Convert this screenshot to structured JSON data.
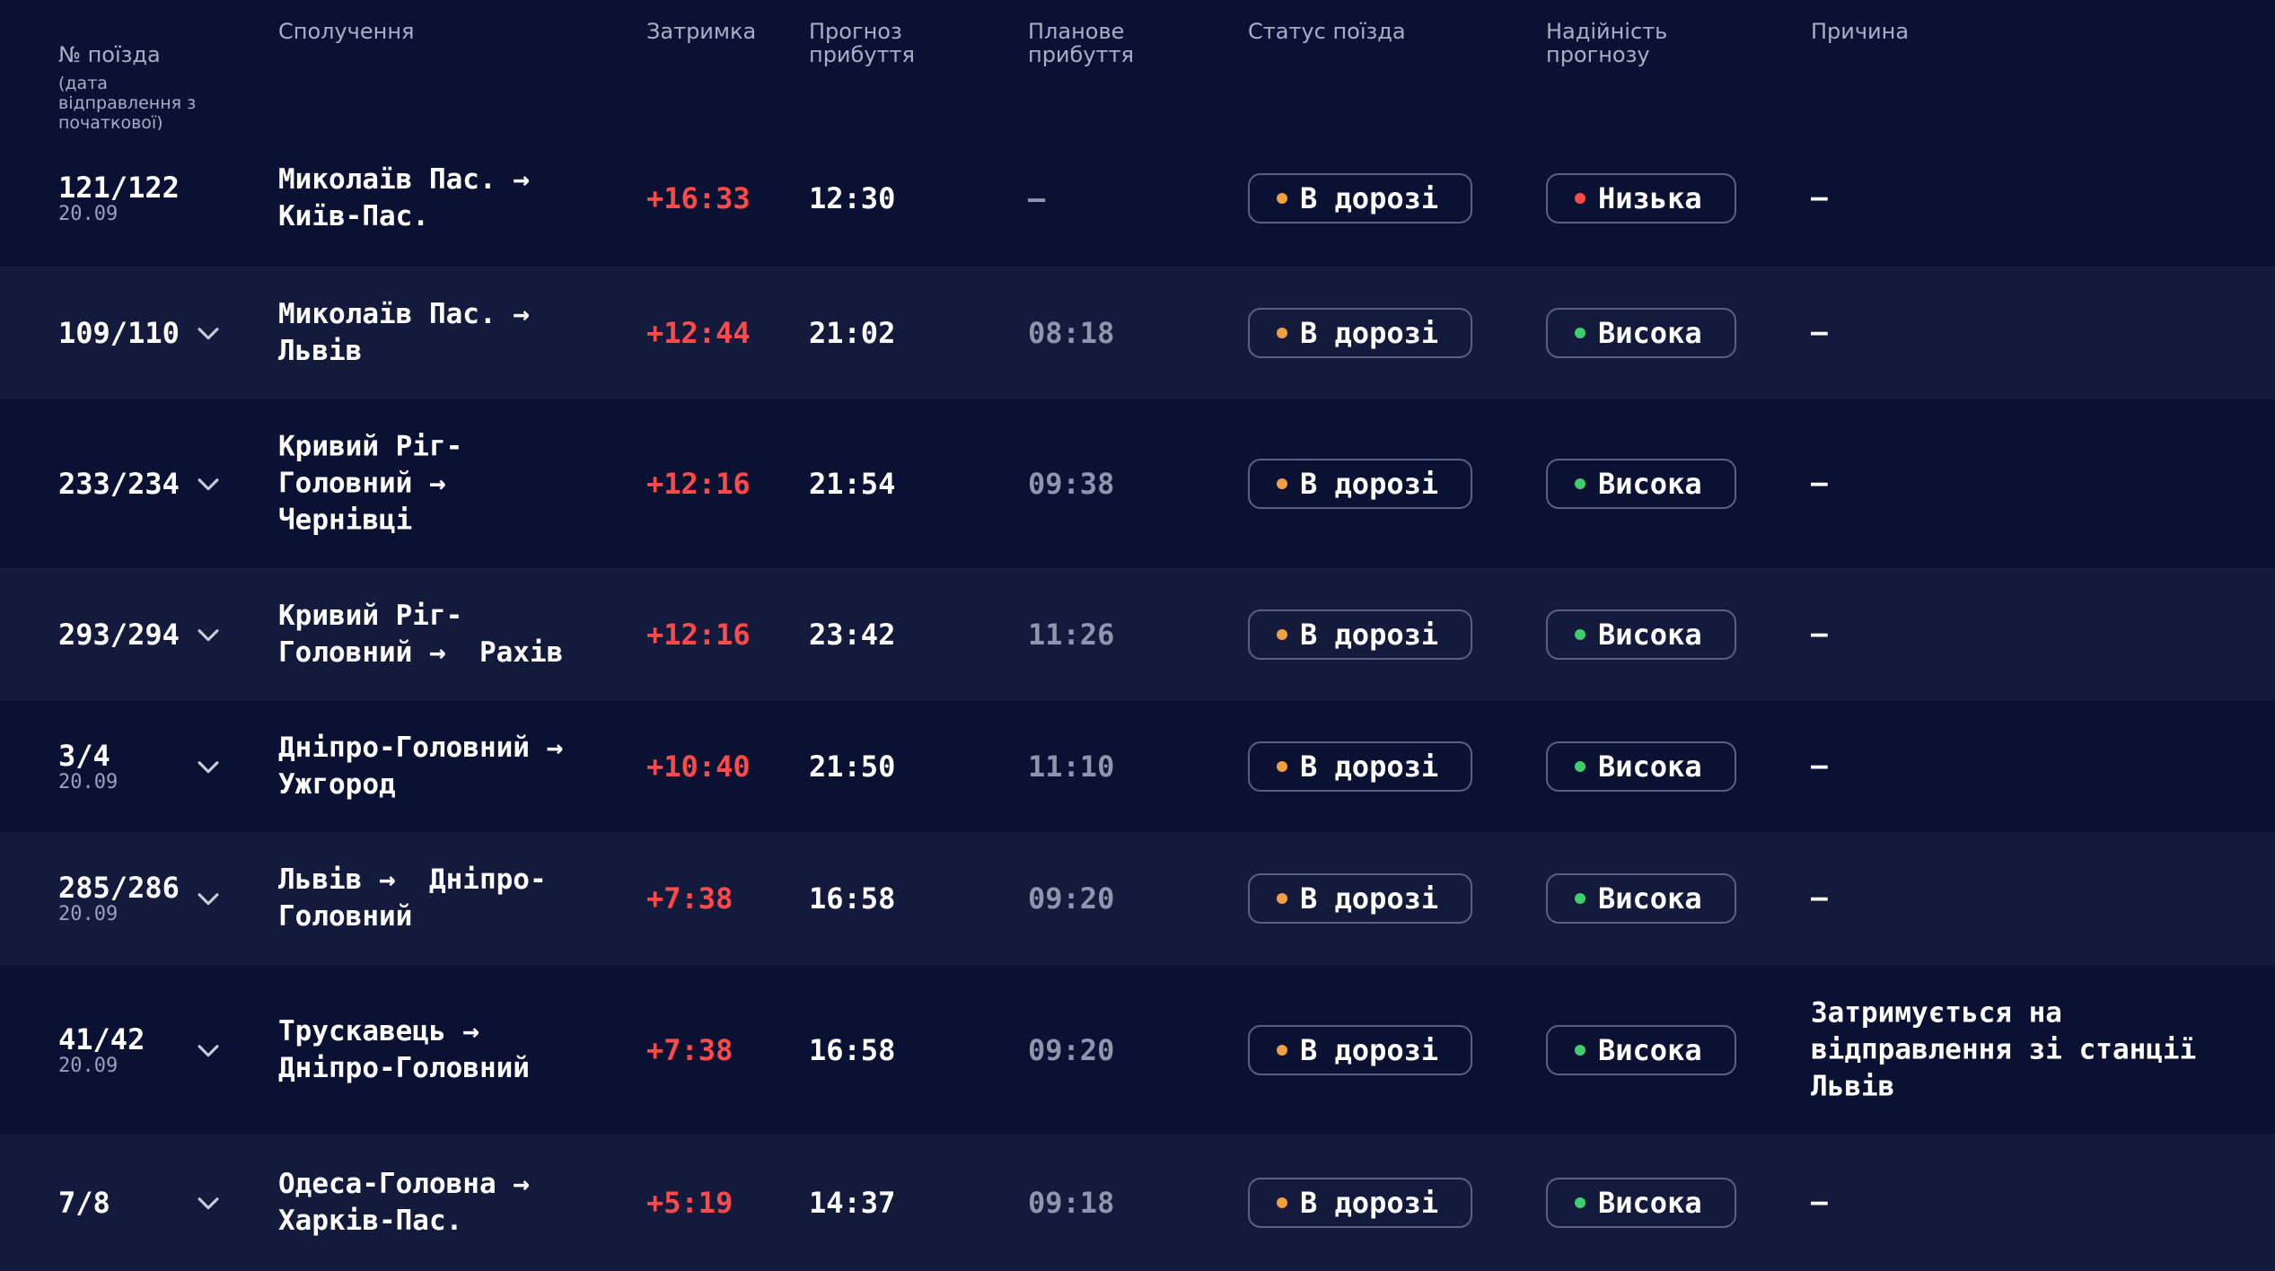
{
  "colors": {
    "background": "#0b1133",
    "row_alt": "#141a3c",
    "delay": "#ff4a4a",
    "dot_enroute": "#f0a040",
    "dot_low": "#ff4a4a",
    "dot_high": "#3ecf6a"
  },
  "header": {
    "train_no": "№ поїзда",
    "train_no_sub": "(дата відправлення з початкової)",
    "route": "Сполучення",
    "delay": "Затримка",
    "forecast": "Прогноз\nприбуття",
    "planned": "Планове\nприбуття",
    "status": "Статус поїзда",
    "reliability": "Надійність\nпрогнозу",
    "reason": "Причина"
  },
  "icons": {
    "expand": "chevron-down-icon",
    "dot": "status-dot-icon"
  },
  "rows": [
    {
      "num": "121/122",
      "date": "20.09",
      "chevron": false,
      "route": "Миколаїв Пас. →\nКиїв-Пас.",
      "delay": "+16:33",
      "forecast": "12:30",
      "planned": "—",
      "status": "В дорозі",
      "reliability": "Низька",
      "rel_level": "low",
      "reason": "—"
    },
    {
      "num": "109/110",
      "date": "",
      "chevron": true,
      "route": "Миколаїв Пас. →\nЛьвів",
      "delay": "+12:44",
      "forecast": "21:02",
      "planned": "08:18",
      "status": "В дорозі",
      "reliability": "Висока",
      "rel_level": "high",
      "reason": "—"
    },
    {
      "num": "233/234",
      "date": "",
      "chevron": true,
      "route": "Кривий Ріг-\nГоловний →\nЧернівці",
      "delay": "+12:16",
      "forecast": "21:54",
      "planned": "09:38",
      "status": "В дорозі",
      "reliability": "Висока",
      "rel_level": "high",
      "reason": "—"
    },
    {
      "num": "293/294",
      "date": "",
      "chevron": true,
      "route": "Кривий Ріг-\nГоловний →  Рахів",
      "delay": "+12:16",
      "forecast": "23:42",
      "planned": "11:26",
      "status": "В дорозі",
      "reliability": "Висока",
      "rel_level": "high",
      "reason": "—"
    },
    {
      "num": "3/4",
      "date": "20.09",
      "chevron": true,
      "route": "Дніпро-Головний →\nУжгород",
      "delay": "+10:40",
      "forecast": "21:50",
      "planned": "11:10",
      "status": "В дорозі",
      "reliability": "Висока",
      "rel_level": "high",
      "reason": "—"
    },
    {
      "num": "285/286",
      "date": "20.09",
      "chevron": true,
      "route": "Львів →  Дніпро-\nГоловний",
      "delay": "+7:38",
      "forecast": "16:58",
      "planned": "09:20",
      "status": "В дорозі",
      "reliability": "Висока",
      "rel_level": "high",
      "reason": "—"
    },
    {
      "num": "41/42",
      "date": "20.09",
      "chevron": true,
      "route": "Трускавець →\nДніпро-Головний",
      "delay": "+7:38",
      "forecast": "16:58",
      "planned": "09:20",
      "status": "В дорозі",
      "reliability": "Висока",
      "rel_level": "high",
      "reason": "Затримується на відправлення зі станції Львів"
    },
    {
      "num": "7/8",
      "date": "",
      "chevron": true,
      "route": "Одеса-Головна →\nХарків-Пас.",
      "delay": "+5:19",
      "forecast": "14:37",
      "planned": "09:18",
      "status": "В дорозі",
      "reliability": "Висока",
      "rel_level": "high",
      "reason": "—"
    }
  ]
}
